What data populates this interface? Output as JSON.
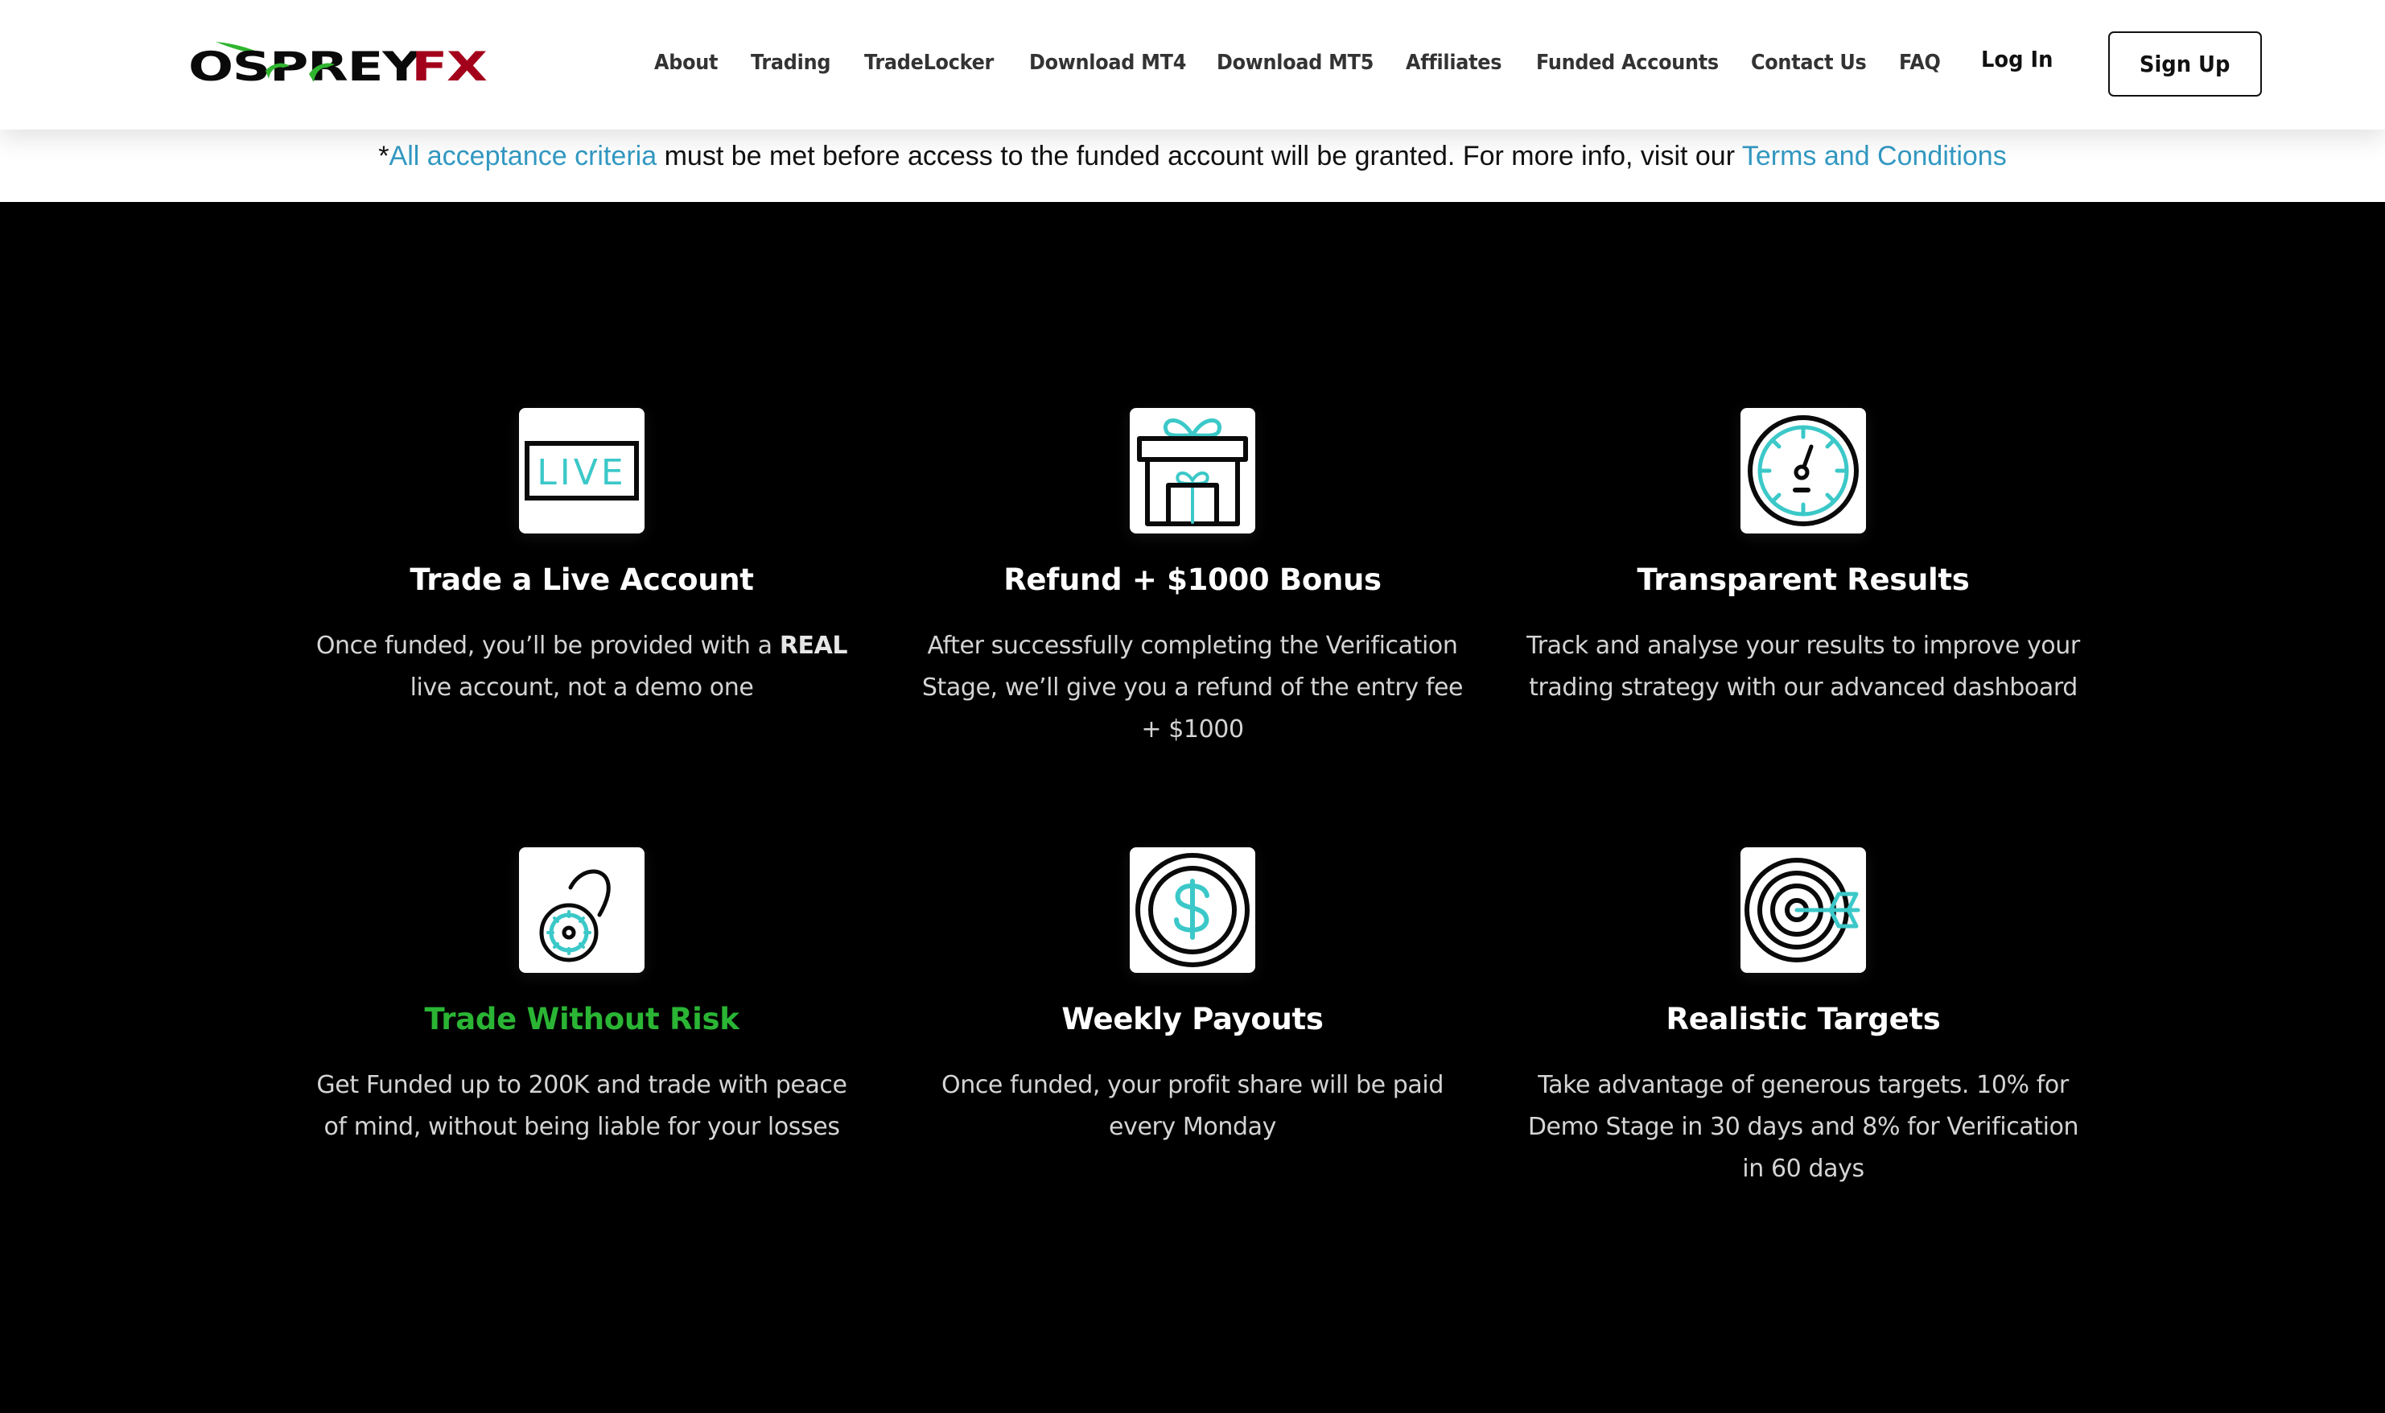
{
  "brand": {
    "name_part1": "OSPREY",
    "name_part2": "FX",
    "colors": {
      "dark": "#0a0a0a",
      "red": "#a3001b",
      "green": "#2fb52f"
    }
  },
  "nav": {
    "items": [
      {
        "label": "About"
      },
      {
        "label": "Trading"
      },
      {
        "label": "TradeLocker"
      },
      {
        "label": "Download MT4"
      },
      {
        "label": "Download MT5"
      },
      {
        "label": "Affiliates"
      },
      {
        "label": "Funded Accounts"
      },
      {
        "label": "Contact Us"
      },
      {
        "label": "FAQ"
      }
    ],
    "login_label": "Log In",
    "signup_label": "Sign Up"
  },
  "notice": {
    "prefix": "*",
    "link1_text": "All acceptance criteria",
    "middle_text": " must be met before access to the funded account will be granted. For more info, visit our ",
    "link2_text": "Terms and Conditions",
    "link_color": "#3399c2"
  },
  "features": [
    {
      "icon": "live-icon",
      "title": "Trade a Live Account",
      "desc_before": "Once funded, you’ll be provided with a ",
      "desc_bold": "REAL",
      "desc_after": " live account, not a demo one"
    },
    {
      "icon": "gift-icon",
      "title": "Refund + $1000 Bonus",
      "desc": "After successfully completing the Verification Stage, we’ll give you a refund of the entry fee + $1000"
    },
    {
      "icon": "speedometer-icon",
      "title": "Transparent Results",
      "desc": "Track and analyse your results to improve your trading strategy with our advanced dashboard"
    },
    {
      "icon": "unlocked-padlock-icon",
      "title": "Trade Without Risk",
      "title_color": "#2ab534",
      "desc": "Get Funded up to 200K and trade with peace of mind, without being liable for your losses"
    },
    {
      "icon": "dollar-coin-icon",
      "title": "Weekly Payouts",
      "desc": "Once funded, your profit share will be paid every Monday"
    },
    {
      "icon": "target-arrow-icon",
      "title": "Realistic Targets",
      "desc": "Take advantage of generous targets. 10% for Demo Stage in 30 days and 8% for Verification in 60 days"
    }
  ],
  "icon_colors": {
    "stroke": "#0a0a0a",
    "accent": "#3cc8c8"
  }
}
